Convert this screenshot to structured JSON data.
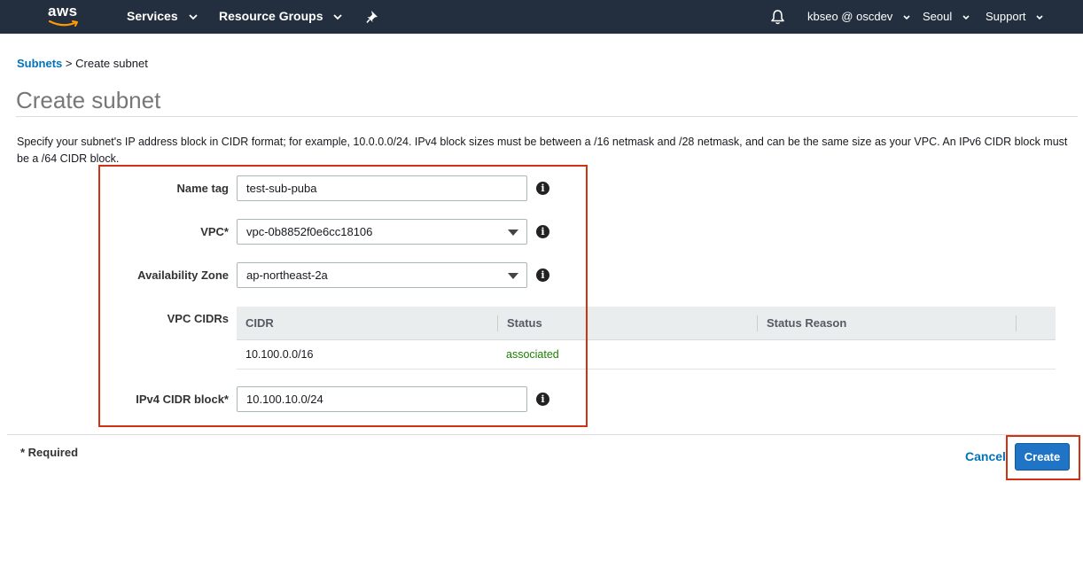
{
  "nav": {
    "logo_text": "aws",
    "services": "Services",
    "resource_groups": "Resource Groups",
    "account": "kbseo @ oscdev",
    "region": "Seoul",
    "support": "Support"
  },
  "breadcrumb": {
    "parent": "Subnets",
    "separator": ">",
    "current": "Create subnet"
  },
  "page": {
    "title": "Create subnet",
    "description": "Specify your subnet's IP address block in CIDR format; for example, 10.0.0.0/24. IPv4 block sizes must be between a /16 netmask and /28 netmask, and can be the same size as your VPC. An IPv6 CIDR block must be a /64 CIDR block."
  },
  "form": {
    "name_tag": {
      "label": "Name tag",
      "value": "test-sub-puba"
    },
    "vpc": {
      "label": "VPC*",
      "value": "vpc-0b8852f0e6cc18106"
    },
    "availability_zone": {
      "label": "Availability Zone",
      "value": "ap-northeast-2a"
    },
    "vpc_cidrs": {
      "label": "VPC CIDRs",
      "columns": [
        "CIDR",
        "Status",
        "Status Reason"
      ],
      "rows": [
        {
          "cidr": "10.100.0.0/16",
          "status": "associated",
          "status_reason": ""
        }
      ]
    },
    "ipv4_cidr": {
      "label": "IPv4 CIDR block*",
      "value": "10.100.10.0/24"
    }
  },
  "footer": {
    "required_note": "* Required",
    "cancel_label": "Cancel",
    "create_label": "Create"
  },
  "colors": {
    "nav_bg": "#232f3e",
    "link": "#0073bb",
    "primary_button": "#1f74c6",
    "status_ok": "#1d8102",
    "highlight": "#d13212"
  },
  "icons": [
    "aws-logo-smile",
    "star-pin-icon",
    "bell-icon",
    "chevron-down-icon",
    "info-icon",
    "dropdown-caret-icon"
  ]
}
